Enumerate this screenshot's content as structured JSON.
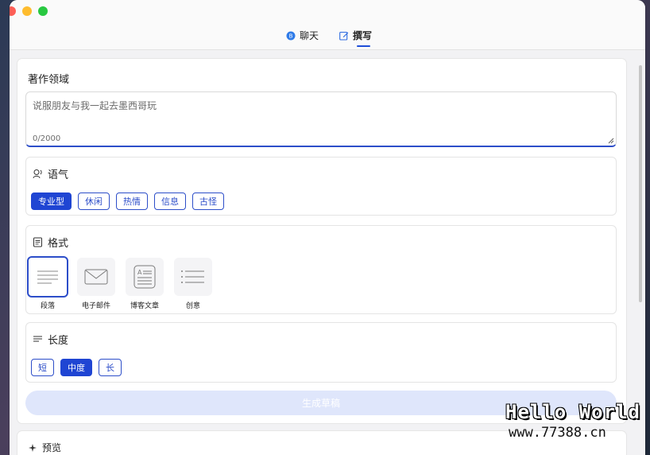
{
  "tabs": [
    {
      "label": "聊天",
      "icon": "chat-bubble-icon",
      "active": false
    },
    {
      "label": "撰写",
      "icon": "edit-icon",
      "active": true
    }
  ],
  "writing": {
    "label": "著作领域",
    "placeholder": "说服朋友与我一起去墨西哥玩",
    "counter": "0/2000"
  },
  "tone": {
    "title": "语气",
    "icon": "voice-tone-icon",
    "options": [
      "专业型",
      "休闲",
      "热情",
      "信息",
      "古怪"
    ],
    "selected": "专业型"
  },
  "format": {
    "title": "格式",
    "icon": "format-doc-icon",
    "options": [
      {
        "label": "段落",
        "icon": "paragraph-icon"
      },
      {
        "label": "电子邮件",
        "icon": "envelope-icon"
      },
      {
        "label": "博客文章",
        "icon": "blog-post-icon"
      },
      {
        "label": "创意",
        "icon": "idea-list-icon"
      }
    ],
    "selected": "段落"
  },
  "length": {
    "title": "长度",
    "icon": "length-lines-icon",
    "options": [
      "短",
      "中度",
      "长"
    ],
    "selected": "中度"
  },
  "generate_label": "生成草稿",
  "preview_label": "预览",
  "watermark": {
    "line1": "Hello World",
    "line2": "www.77388.cn"
  },
  "colors": {
    "accent": "#1f45d3",
    "disabled_button": "#dfe6fb"
  }
}
